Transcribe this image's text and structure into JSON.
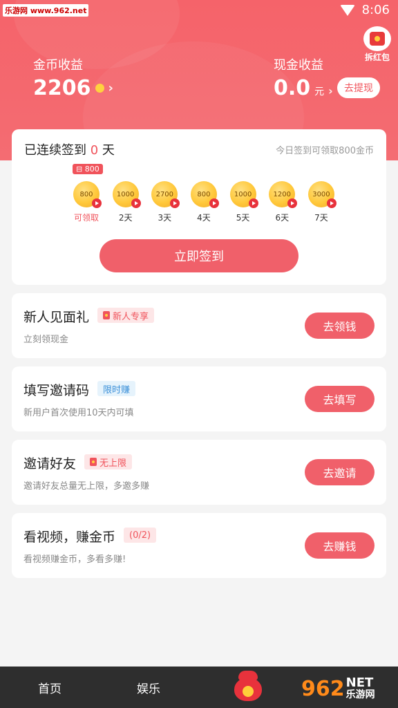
{
  "status_bar": {
    "watermark": "乐游网 www.962.net",
    "time": "8:06",
    "wifi_icon": "wifi-icon"
  },
  "header": {
    "open_envelope_label": "拆红包",
    "coin_label": "金币收益",
    "coin_value": "2206",
    "chevron": "›",
    "cash_label": "现金收益",
    "cash_value": "0.0",
    "cash_unit": "元",
    "withdraw_label": "去提现",
    "accent_color": "#f5636a"
  },
  "signin": {
    "title_prefix": "已连续签到",
    "days_count": "0",
    "title_suffix": "天",
    "tip": "今日签到可领取800金币",
    "today_tag": "800",
    "days": [
      {
        "amount": "800",
        "label": "可领取"
      },
      {
        "amount": "1000",
        "label": "2天"
      },
      {
        "amount": "2700",
        "label": "3天"
      },
      {
        "amount": "800",
        "label": "4天"
      },
      {
        "amount": "1000",
        "label": "5天"
      },
      {
        "amount": "1200",
        "label": "6天"
      },
      {
        "amount": "3000",
        "label": "7天"
      }
    ],
    "button_label": "立即签到"
  },
  "tasks": [
    {
      "title": "新人见面礼",
      "badge": "新人专享",
      "subtitle": "立刻领现金",
      "button": "去领钱"
    },
    {
      "title": "填写邀请码",
      "badge": "限时赚",
      "subtitle": "新用户首次使用10天内可填",
      "button": "去填写"
    },
    {
      "title": "邀请好友",
      "badge": "无上限",
      "subtitle": "邀请好友总量无上限，多邀多赚",
      "button": "去邀请"
    },
    {
      "title": "看视频，赚金币",
      "badge": "(0/2)",
      "subtitle": "看视频赚金币，多看多赚!",
      "button": "去赚钱"
    }
  ],
  "bottom_nav": {
    "home": "首页",
    "entertainment": "娱乐",
    "bag_icon": "lucky-bag-icon",
    "logo_num": "962",
    "logo_net": "NET",
    "logo_cn": "乐游网"
  }
}
